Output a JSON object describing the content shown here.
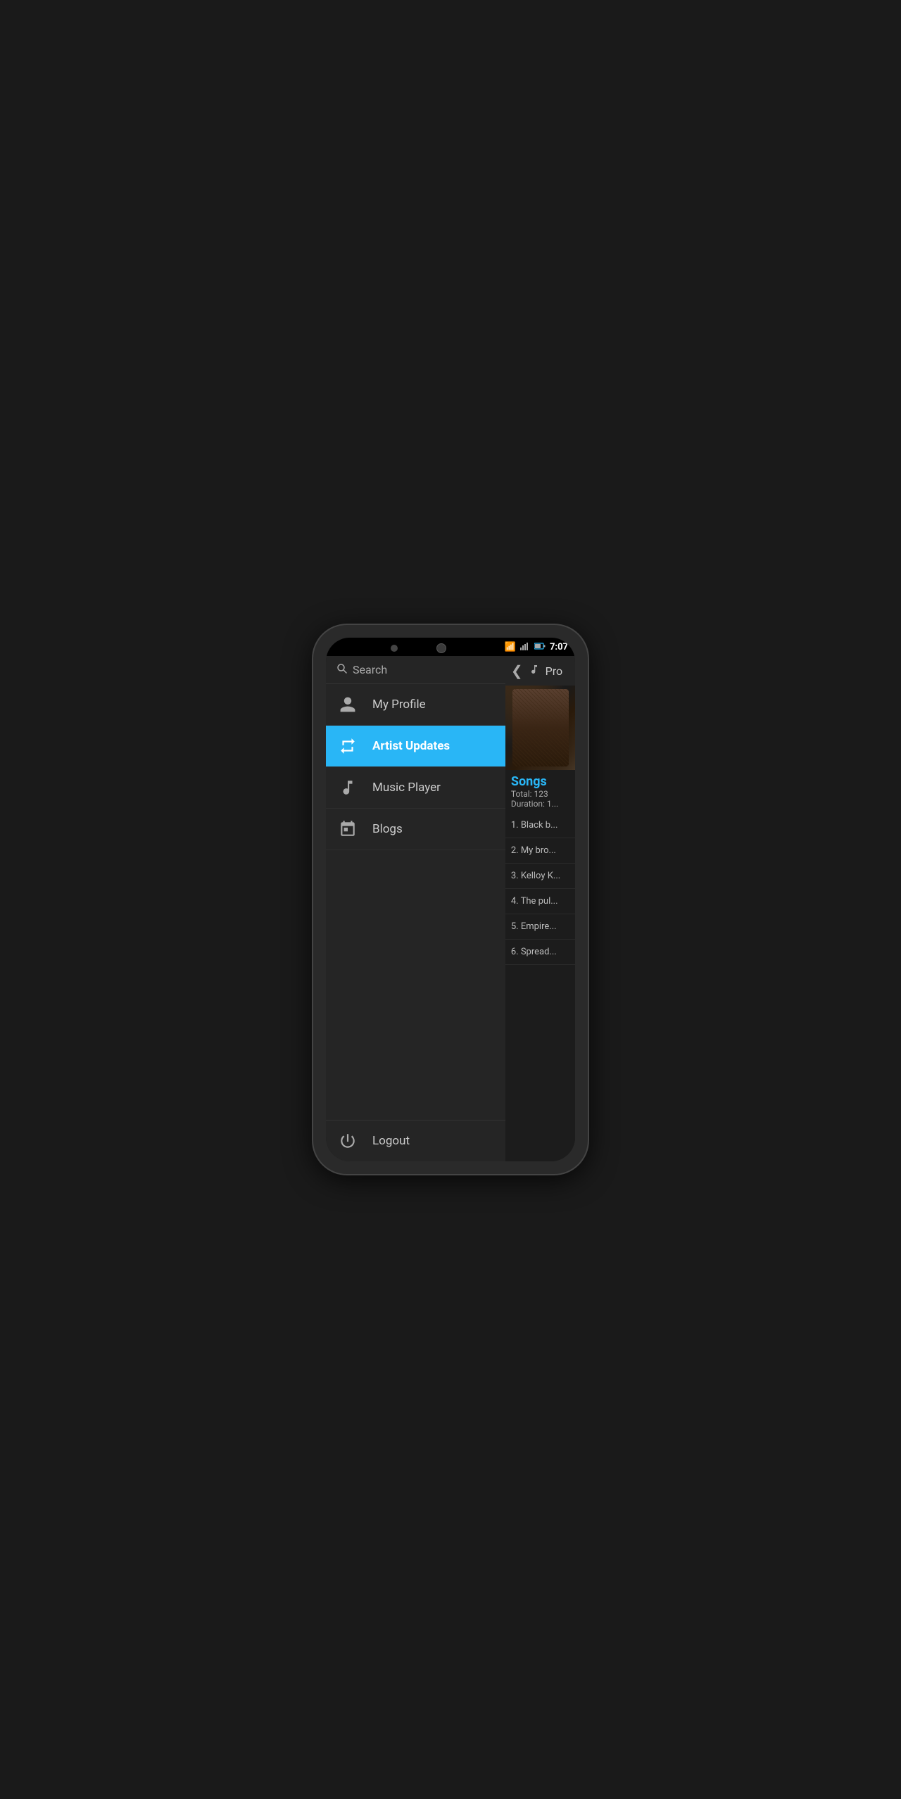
{
  "phone": {
    "status_bar": {
      "time": "7:07"
    }
  },
  "drawer": {
    "search": {
      "placeholder": "Search"
    },
    "nav_items": [
      {
        "id": "my-profile",
        "label": "My Profile",
        "icon": "person",
        "active": false
      },
      {
        "id": "artist-updates",
        "label": "Artist Updates",
        "icon": "repeat",
        "active": true
      },
      {
        "id": "music-player",
        "label": "Music Player",
        "icon": "music",
        "active": false
      },
      {
        "id": "blogs",
        "label": "Blogs",
        "icon": "calendar",
        "active": false
      }
    ],
    "logout": {
      "label": "Logout"
    }
  },
  "main": {
    "topbar": {
      "title": "Pro"
    },
    "album": {
      "songs_title": "Songs",
      "total": "Total: 123",
      "duration": "Duration: 1..."
    },
    "song_list": [
      {
        "index": 1,
        "title": "Black b..."
      },
      {
        "index": 2,
        "title": "My bro..."
      },
      {
        "index": 3,
        "title": "Kelloy K..."
      },
      {
        "index": 4,
        "title": "The pul..."
      },
      {
        "index": 5,
        "title": "Empire..."
      },
      {
        "index": 6,
        "title": "Spread..."
      }
    ]
  }
}
